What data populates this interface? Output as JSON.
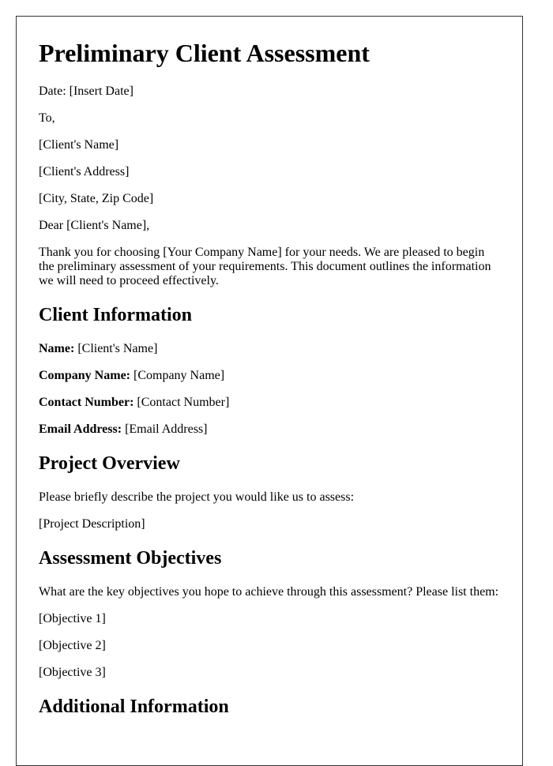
{
  "document": {
    "title": "Preliminary Client Assessment",
    "header_lines": {
      "date": "Date: [Insert Date]",
      "to": "To,",
      "client_name": "[Client's Name]",
      "client_address": "[Client's Address]",
      "city_state_zip": "[City, State, Zip Code]",
      "salutation": "Dear [Client's Name],"
    },
    "intro": "Thank you for choosing [Your Company Name] for your needs. We are pleased to begin the preliminary assessment of your requirements. This document outlines the information we will need to proceed effectively.",
    "client_information": {
      "heading": "Client Information",
      "fields": [
        {
          "label": "Name:",
          "value": "[Client's Name]"
        },
        {
          "label": "Company Name:",
          "value": "[Company Name]"
        },
        {
          "label": "Contact Number:",
          "value": "[Contact Number]"
        },
        {
          "label": "Email Address:",
          "value": "[Email Address]"
        }
      ]
    },
    "project_overview": {
      "heading": "Project Overview",
      "prompt": "Please briefly describe the project you would like us to assess:",
      "placeholder": "[Project Description]"
    },
    "assessment_objectives": {
      "heading": "Assessment Objectives",
      "prompt": "What are the key objectives you hope to achieve through this assessment? Please list them:",
      "items": [
        "[Objective 1]",
        "[Objective 2]",
        "[Objective 3]"
      ]
    },
    "additional_information": {
      "heading": "Additional Information"
    }
  }
}
